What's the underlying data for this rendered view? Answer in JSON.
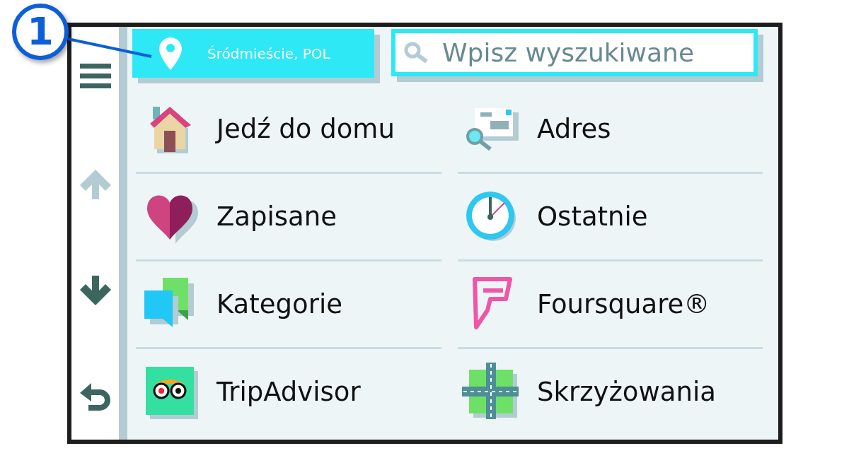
{
  "callout": {
    "label": "1"
  },
  "sidebar": [
    {
      "kind": "menu",
      "disabled": false
    },
    {
      "kind": "up",
      "disabled": true
    },
    {
      "kind": "down",
      "disabled": false
    },
    {
      "kind": "back",
      "disabled": false
    }
  ],
  "location_button": {
    "label": "Śródmieście, POL"
  },
  "search": {
    "placeholder": "Wpisz wyszukiwane"
  },
  "items": [
    {
      "kind": "home",
      "label": "Jedź do domu"
    },
    {
      "kind": "address",
      "label": "Adres"
    },
    {
      "kind": "saved",
      "label": "Zapisane"
    },
    {
      "kind": "recent",
      "label": "Ostatnie"
    },
    {
      "kind": "categories",
      "label": "Kategorie"
    },
    {
      "kind": "foursquare",
      "label": "Foursquare®"
    },
    {
      "kind": "tripadvisor",
      "label": "TripAdvisor"
    },
    {
      "kind": "intersections",
      "label": "Skrzyżowania"
    }
  ]
}
